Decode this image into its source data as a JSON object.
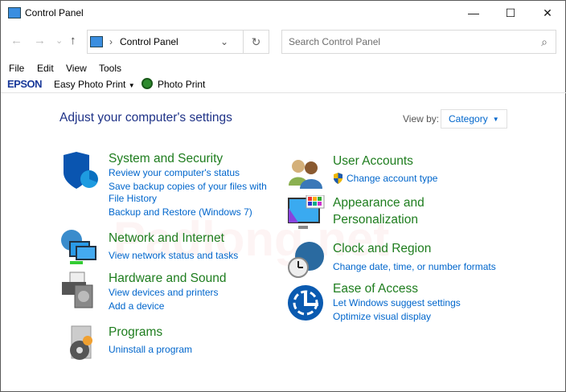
{
  "window": {
    "title": "Control Panel",
    "minimize": "—",
    "maximize": "☐",
    "close": "✕"
  },
  "nav": {
    "back": "←",
    "forward": "→",
    "recent": "⌄",
    "up": "↑",
    "address": "Control Panel",
    "separator": "›",
    "dropdown": "⌄",
    "refresh": "↻",
    "search_placeholder": "Search Control Panel",
    "search_icon": "⌕"
  },
  "menu": [
    "File",
    "Edit",
    "View",
    "Tools"
  ],
  "toolbar": {
    "brand": "EPSON",
    "easy_photo": "Easy Photo Print",
    "photo_print": "Photo Print"
  },
  "main": {
    "heading": "Adjust your computer's settings",
    "view_by_label": "View by:",
    "view_by_value": "Category"
  },
  "watermark": "Padlong.net",
  "categories": [
    {
      "title": "System and Security",
      "links": [
        "Review your computer's status",
        "Save backup copies of your files with",
        "File History",
        "Backup and Restore (Windows 7)"
      ]
    },
    {
      "title": "Network and Internet",
      "links": [
        "View network status and tasks"
      ]
    },
    {
      "title": "Hardware and Sound",
      "links": [
        "View devices and printers",
        "Add a device"
      ]
    },
    {
      "title": "Programs",
      "links": [
        "Uninstall a program"
      ]
    },
    {
      "title": "User Accounts",
      "links": [
        "Change account type"
      ]
    },
    {
      "title": "Appearance and",
      "title2": "Personalization",
      "links": []
    },
    {
      "title": "Clock and Region",
      "links": [
        "Change date, time, or number formats"
      ]
    },
    {
      "title": "Ease of Access",
      "links": [
        "Let Windows suggest settings",
        "Optimize visual display"
      ]
    }
  ]
}
